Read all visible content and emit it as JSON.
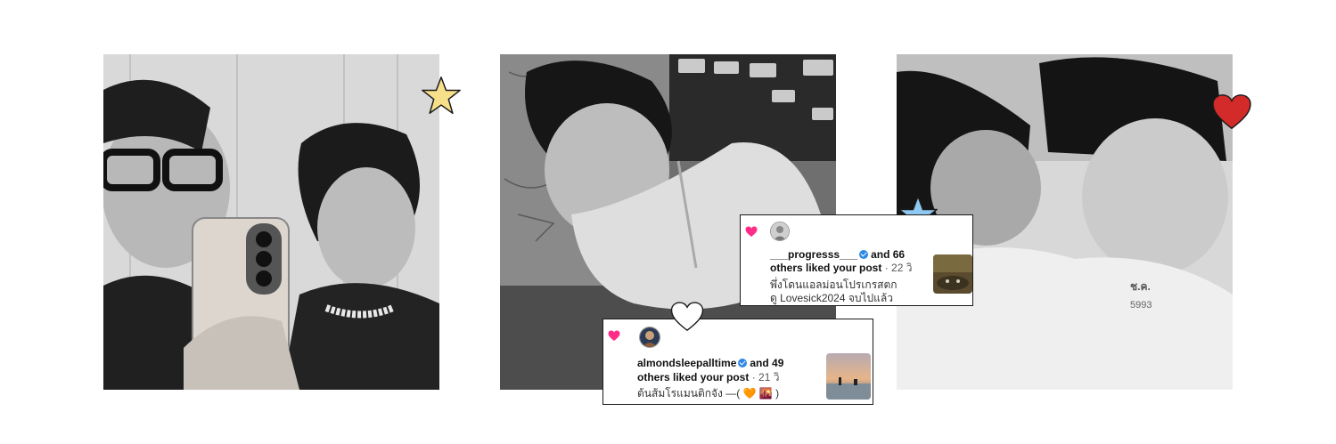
{
  "notifications": [
    {
      "username": "___progresss___",
      "liked_prefix": "and 66",
      "liked_suffix": "others liked your post",
      "time": "· 22 วิ",
      "caption_line1": "พึ่งโดนแอลม่อนโปรเกรสตก",
      "caption_line2": "ดู Lovesick2024 จบไปแล้ว"
    },
    {
      "username": "almondsleepalltime",
      "liked_prefix": "and 49",
      "liked_suffix": "others liked your post",
      "time": "· 21 วิ",
      "caption_line1": "ต้นส้มโรแมนติกจัง —( 🧡 🌇 )"
    }
  ],
  "colors": {
    "star_yellow": "#f7e08a",
    "star_blue": "#8ec9f2",
    "heart_red": "#d32a2a",
    "heart_white": "#ffffff",
    "notification_heart": "#ff2d87",
    "verified_badge": "#2d88e6"
  },
  "icons": [
    "star-icon",
    "heart-icon",
    "verified-badge-icon"
  ]
}
